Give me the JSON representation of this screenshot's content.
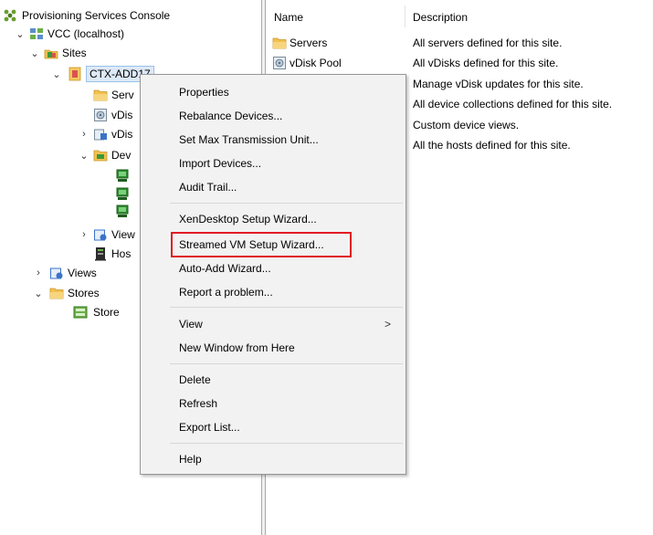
{
  "tree": {
    "root_label": "Provisioning Services Console",
    "farm_label": "VCC (localhost)",
    "sites_label": "Sites",
    "site_label": "CTX-ADD17",
    "servers_label": "Serv",
    "vdisk_pool_label": "vDis",
    "vdisk_updates_label": "vDis",
    "devices_label": "Dev",
    "site_views_label": "View",
    "hosts_label": "Hos",
    "views_label": "Views",
    "stores_label": "Stores",
    "store_label": "Store"
  },
  "list": {
    "col_name": "Name",
    "col_description": "Description",
    "rows": [
      {
        "name": "Servers",
        "desc": "All servers defined for this site."
      },
      {
        "name": "vDisk Pool",
        "desc": "All vDisks defined for this site."
      },
      {
        "name": "",
        "desc": "Manage vDisk updates for this site."
      },
      {
        "name": "",
        "desc": "All device collections defined for this site."
      },
      {
        "name": "",
        "desc": "Custom device views."
      },
      {
        "name": "",
        "desc": "All the hosts defined for this site."
      }
    ]
  },
  "menu": {
    "properties": "Properties",
    "rebalance": "Rebalance Devices...",
    "set_mtu": "Set Max Transmission Unit...",
    "import": "Import Devices...",
    "audit": "Audit Trail...",
    "xendesktop": "XenDesktop Setup Wizard...",
    "streamed_vm": "Streamed VM Setup Wizard...",
    "auto_add": "Auto-Add Wizard...",
    "report": "Report a problem...",
    "view": "View",
    "view_arrow": ">",
    "new_window": "New Window from Here",
    "delete": "Delete",
    "refresh": "Refresh",
    "export": "Export List...",
    "help": "Help"
  },
  "colors": {
    "highlight": "#e01b24",
    "folder": "#f2c14e",
    "server_green": "#3a9a3a"
  }
}
